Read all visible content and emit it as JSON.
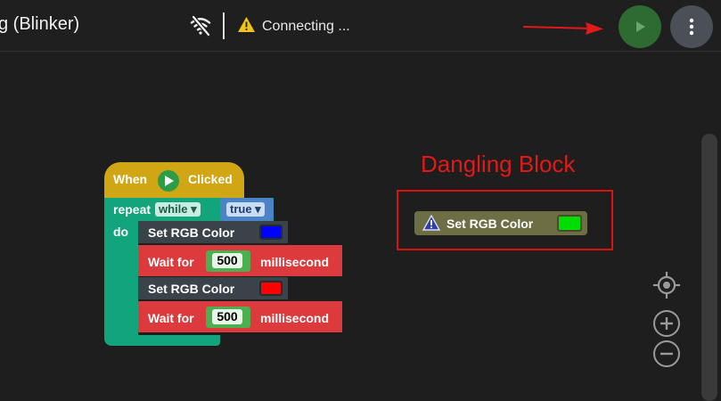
{
  "header": {
    "title": "g (Blinker)",
    "status_text": "Connecting ...",
    "status_icon": "warning-icon",
    "wifi_icon": "wifi-off-icon",
    "run_icon": "play-icon",
    "more_icon": "more-vert-icon",
    "colors": {
      "run": "#2e6b33",
      "more": "#4b5058",
      "arrow": "#e21919"
    }
  },
  "program": {
    "event": {
      "when_label": "When",
      "clicked_label": "Clicked"
    },
    "loop": {
      "repeat_label": "repeat",
      "mode_value": "while ▾",
      "condition_value": "true ▾",
      "do_label": "do"
    },
    "statements": [
      {
        "label": "Set RGB Color",
        "color": "#0000ff"
      },
      {
        "label": "Wait for",
        "value": "500",
        "unit": "millisecond"
      },
      {
        "label": "Set RGB Color",
        "color": "#ff0000"
      },
      {
        "label": "Wait for",
        "value": "500",
        "unit": "millisecond"
      }
    ]
  },
  "annotation": {
    "text": "Dangling Block"
  },
  "dangling_block": {
    "label": "Set RGB Color",
    "color": "#00dd00",
    "icon": "warning-icon"
  },
  "workspace_controls": [
    "recenter-icon",
    "zoom-in-icon",
    "zoom-out-icon"
  ]
}
